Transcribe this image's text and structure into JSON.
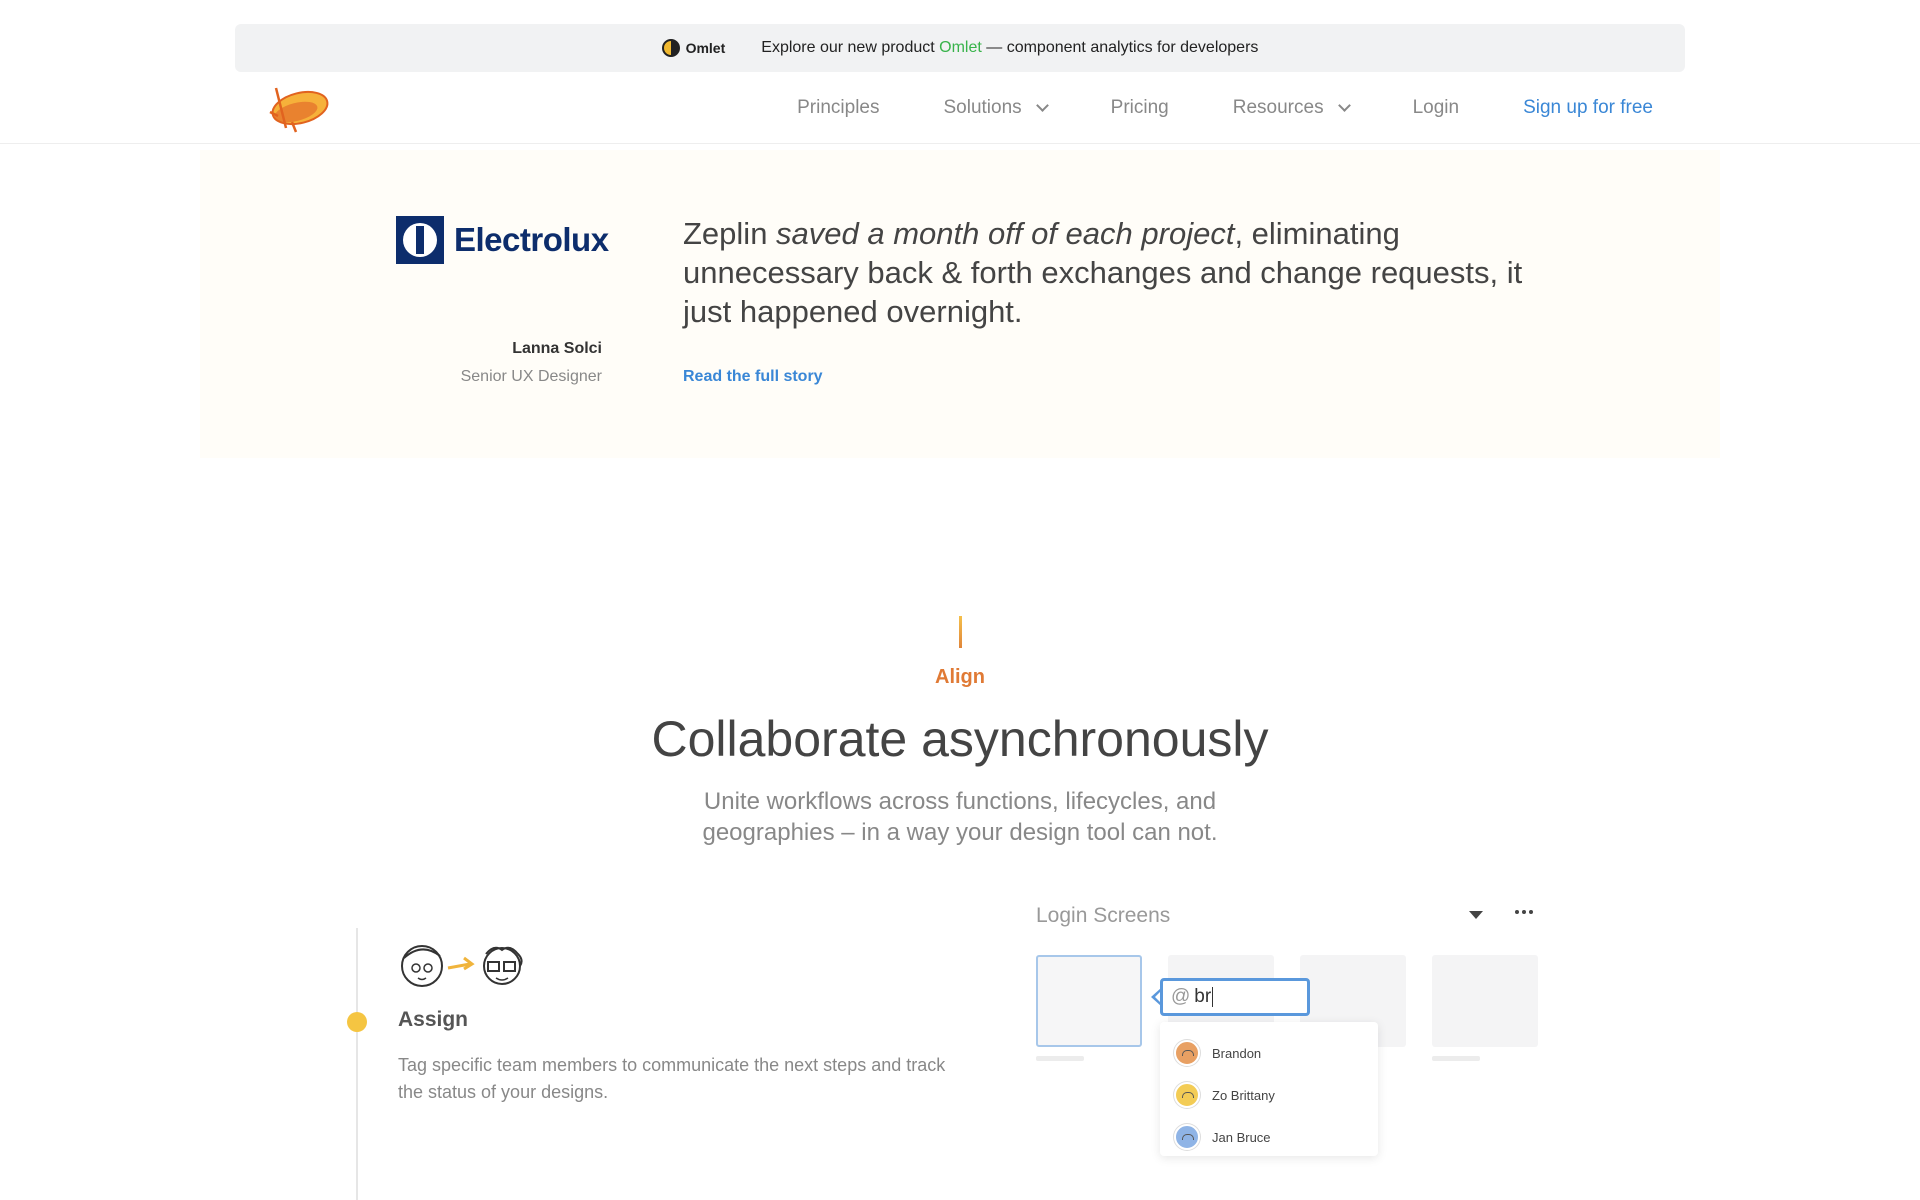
{
  "announcement": {
    "brand": "Omlet",
    "text_before": "Explore our new product ",
    "link": "Omlet",
    "text_after": " — component analytics for developers"
  },
  "nav": {
    "items": [
      {
        "label": "Principles"
      },
      {
        "label": "Solutions"
      },
      {
        "label": "Pricing"
      },
      {
        "label": "Resources"
      },
      {
        "label": "Login"
      },
      {
        "label": "Sign up for free"
      }
    ]
  },
  "testimonial": {
    "company": "Electrolux",
    "quote_start": "Zeplin ",
    "quote_emphasis": "saved a month off of each project",
    "quote_end": ", eliminating unnecessary back & forth exchanges and change requests, it just happened overnight.",
    "person_name": "Lanna Solci",
    "person_role": "Senior UX Designer",
    "link": "Read the full story"
  },
  "section": {
    "eyebrow": "Align",
    "title": "Collaborate asynchronously",
    "subtitle": "Unite workflows across functions, lifecycles, and geographies – in a way your design tool can not."
  },
  "feature": {
    "title": "Assign",
    "description": "Tag specific team members to communicate the next steps and track the status of your designs."
  },
  "mock": {
    "title": "Login Screens",
    "mention_at": "@",
    "mention_query": "br",
    "suggestions": [
      {
        "name": "Brandon",
        "color": "#e8a063"
      },
      {
        "name": "Zo Brittany",
        "color": "#f3cc55"
      },
      {
        "name": "Jan Bruce",
        "color": "#8fb4e6"
      }
    ]
  },
  "colors": {
    "accent_blue": "#3a87d6",
    "omlet_green": "#38b34a",
    "align_orange": "#e07a35",
    "timeline_dot": "#f5c542"
  }
}
